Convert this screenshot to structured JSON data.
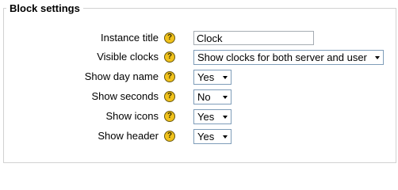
{
  "fieldset": {
    "legend": "Block settings"
  },
  "help_glyph": "?",
  "fields": {
    "instance_title": {
      "label": "Instance title",
      "value": "Clock"
    },
    "visible_clocks": {
      "label": "Visible clocks",
      "selected": "Show clocks for both server and user"
    },
    "show_day_name": {
      "label": "Show day name",
      "selected": "Yes"
    },
    "show_seconds": {
      "label": "Show seconds",
      "selected": "No"
    },
    "show_icons": {
      "label": "Show icons",
      "selected": "Yes"
    },
    "show_header": {
      "label": "Show header",
      "selected": "Yes"
    }
  },
  "colors": {
    "border": "#d2d2d2",
    "help_icon": "#f1c21b"
  },
  "icons": {
    "help": "help-icon",
    "dropdown": "chevron-down-icon"
  }
}
